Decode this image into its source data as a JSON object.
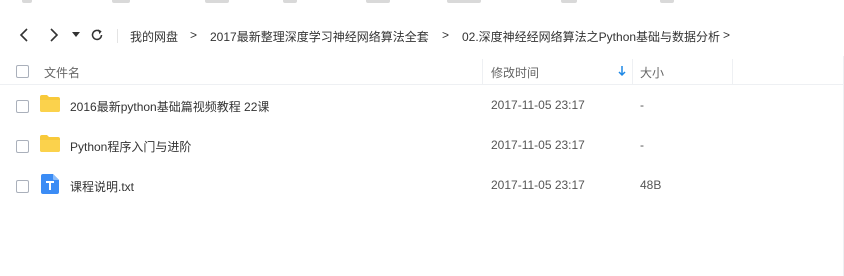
{
  "nav": {
    "back_icon": "chevron-left-icon",
    "forward_icon": "chevron-right-icon",
    "dropdown_icon": "caret-down-icon",
    "refresh_icon": "refresh-icon"
  },
  "breadcrumb": {
    "items": [
      "我的网盘",
      "2017最新整理深度学习神经网络算法全套",
      "02.深度神经经网络算法之Python基础与数据分析"
    ],
    "separator": ">"
  },
  "table": {
    "columns": {
      "name": "文件名",
      "modified": "修改时间",
      "size": "大小"
    },
    "sort_icon": "sort-down-arrow-icon",
    "rows": [
      {
        "icon": "folder-icon",
        "name": "2016最新python基础篇视频教程  22课",
        "modified": "2017-11-05 23:17",
        "size": "-"
      },
      {
        "icon": "folder-icon",
        "name": "Python程序入门与进阶",
        "modified": "2017-11-05 23:17",
        "size": "-"
      },
      {
        "icon": "text-file-icon",
        "name": "课程说明.txt",
        "modified": "2017-11-05 23:17",
        "size": "48B"
      }
    ]
  },
  "colors": {
    "folder": "#f8c93a",
    "txt_icon": "#3b8cf5",
    "sort_arrow": "#1e88e5"
  }
}
